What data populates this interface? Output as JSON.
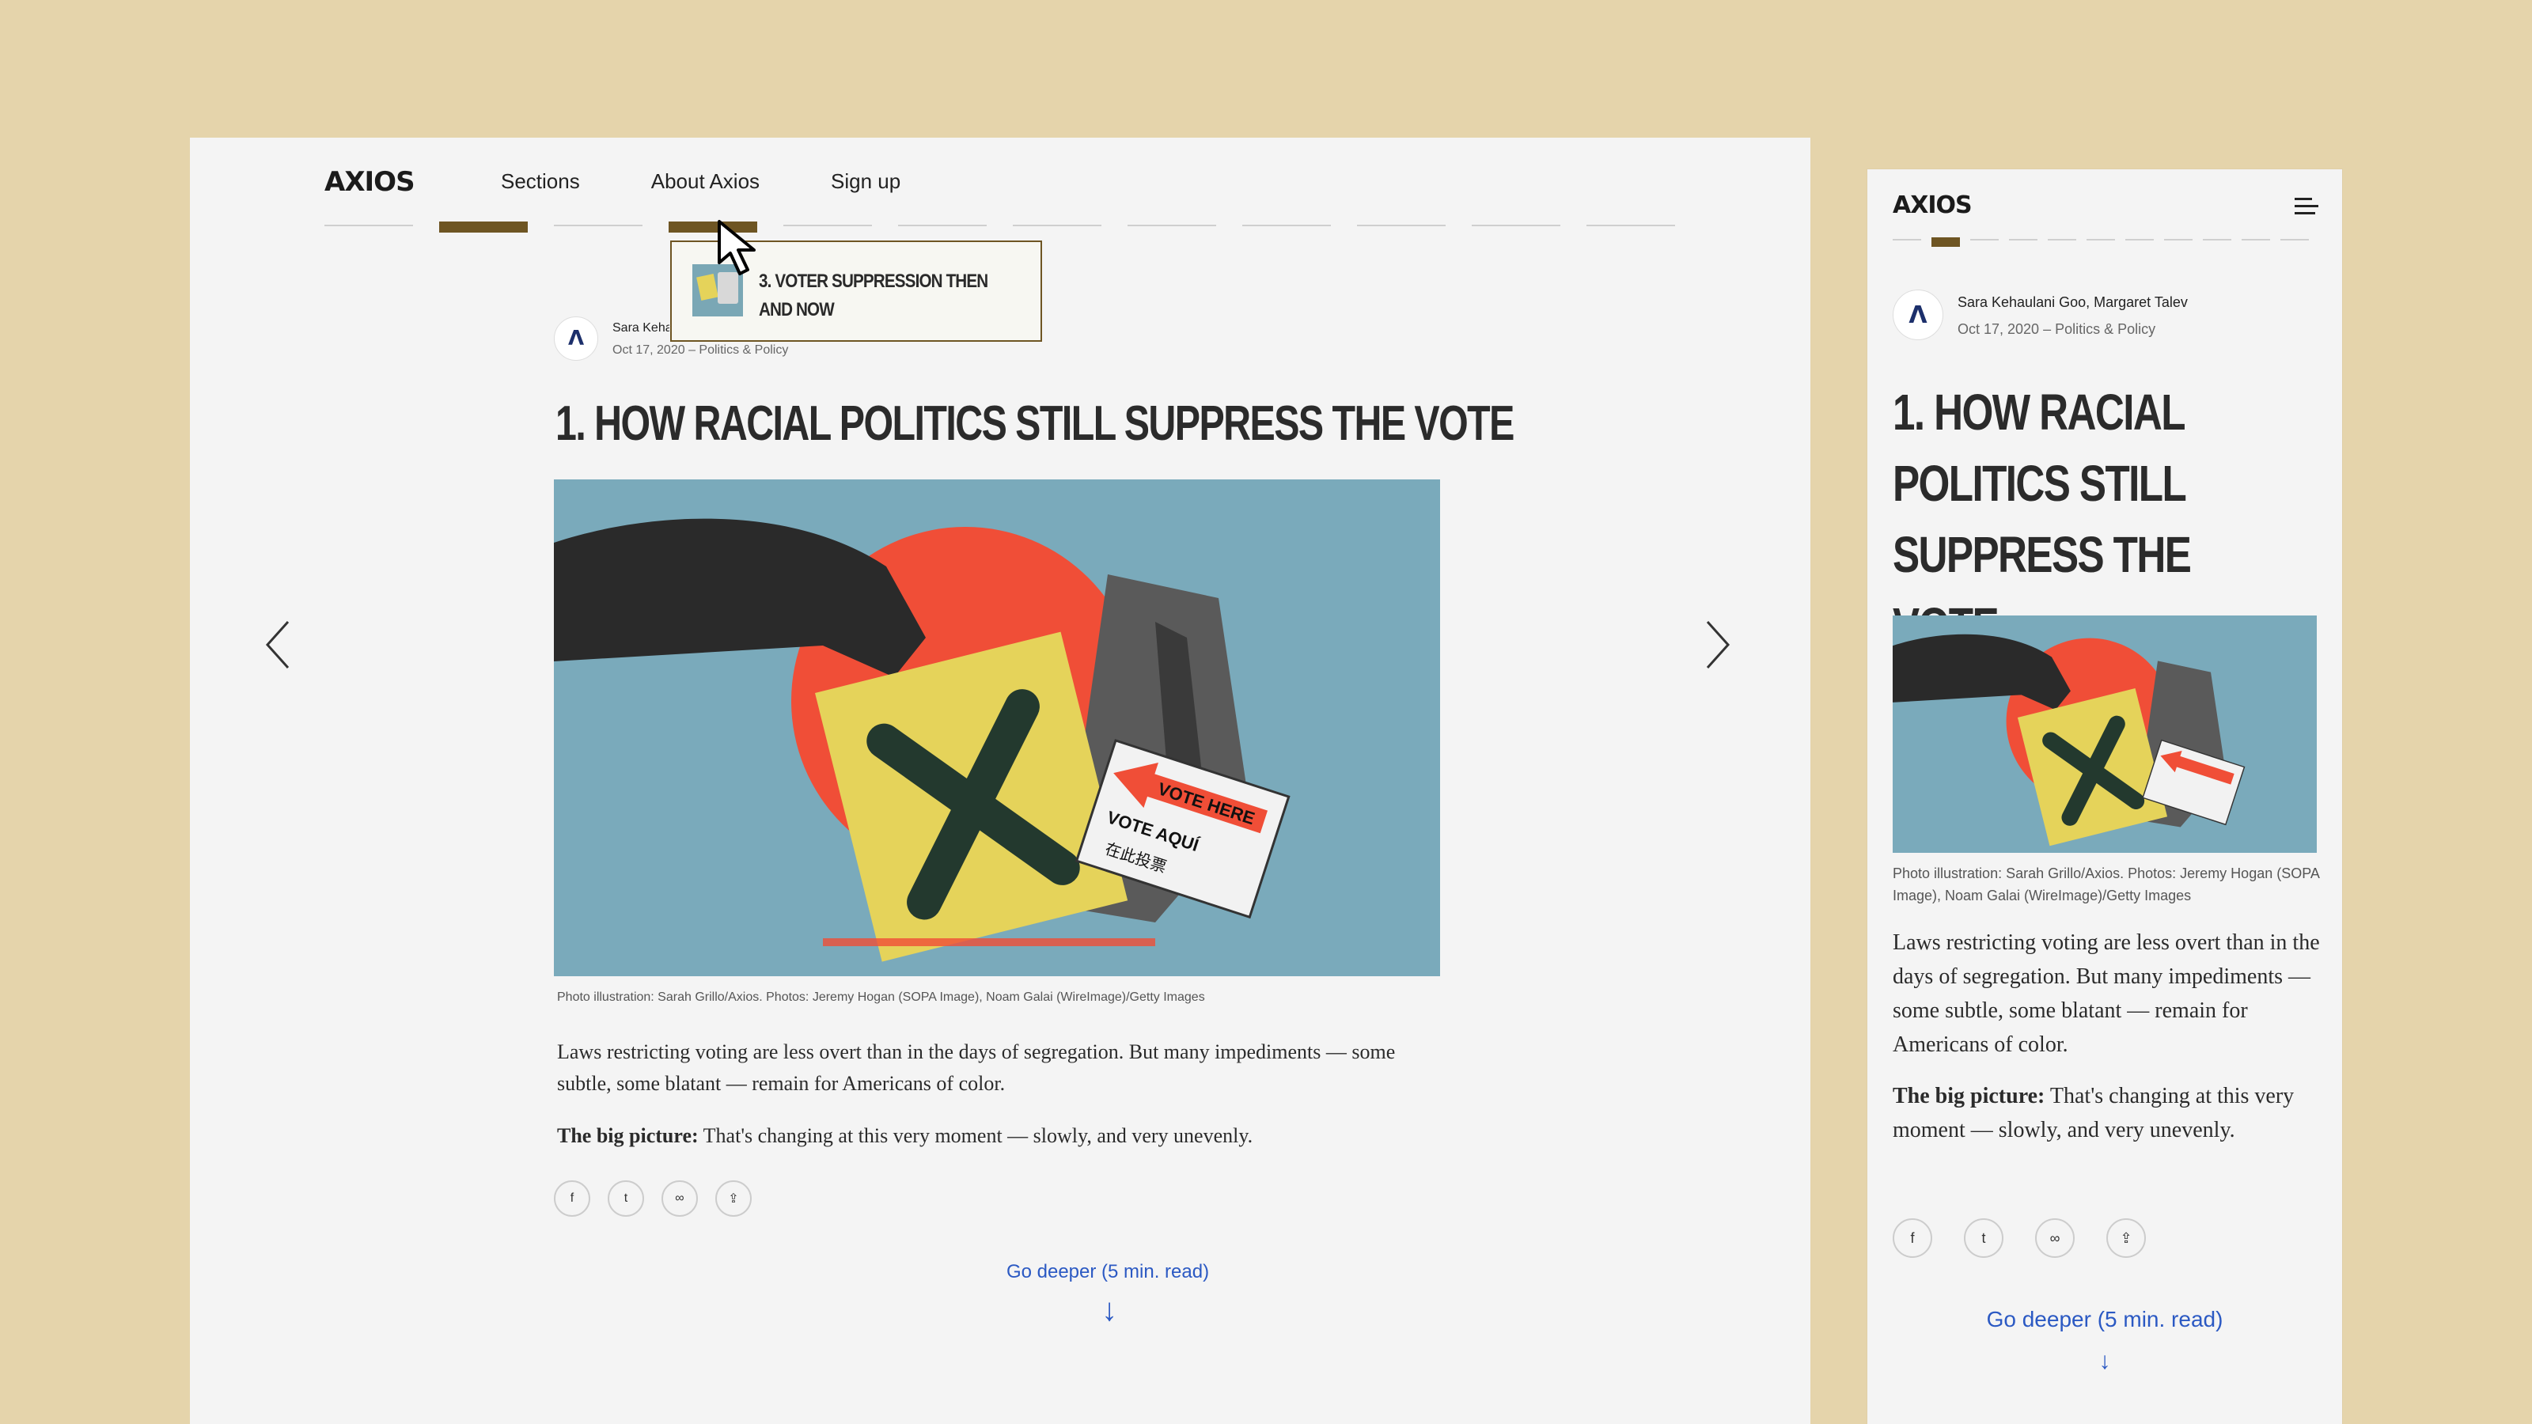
{
  "brand": {
    "logo": "AXIOS",
    "accent": "#6e5523",
    "link_color": "#2b59c3",
    "background": "#e5d4ab"
  },
  "desktop": {
    "nav": {
      "sections": "Sections",
      "about": "About Axios",
      "signup": "Sign up"
    },
    "progress": {
      "total": 12,
      "active_index": 1,
      "hovered_index": 3
    },
    "tooltip": {
      "title": "3. VOTER SUPPRESSION THEN AND NOW"
    },
    "byline": {
      "author_truncated": "Sara Kehaulani Goo, Margaret Talev",
      "meta": "Oct 17, 2020 – Politics & Policy"
    },
    "headline": "1. HOW RACIAL POLITICS STILL SUPPRESS THE VOTE",
    "caption": "Photo illustration: Sarah Grillo/Axios. Photos: Jeremy Hogan (SOPA Image), Noam Galai (WireImage)/Getty Images",
    "body1": "Laws restricting voting are less overt than in the days of segregation. But many impediments — some subtle, some blatant — remain for Americans of color.",
    "body2_lead": "The big picture:",
    "body2_rest": " That's changing at this very moment — slowly, and very unevenly.",
    "go_deeper": "Go deeper (5 min. read)",
    "arrow": "↓",
    "share_icons": [
      "facebook-icon",
      "twitter-icon",
      "link-icon",
      "share-icon"
    ],
    "share_glyphs": [
      "f",
      "t",
      "∞",
      "⇪"
    ]
  },
  "mobile": {
    "progress": {
      "total": 11,
      "active_index": 1
    },
    "byline": {
      "author": "Sara Kehaulani Goo, Margaret Talev",
      "meta": "Oct 17, 2020 – Politics & Policy"
    },
    "headline": "1. HOW RACIAL POLITICS STILL SUPPRESS THE VOTE",
    "caption": "Photo illustration: Sarah Grillo/Axios. Photos: Jeremy Hogan (SOPA Image), Noam Galai (WireImage)/Getty Images",
    "body1": "Laws restricting voting are less overt than in the days of segregation. But many impediments — some subtle, some blatant — remain for Americans of color.",
    "body2_lead": "The big picture:",
    "body2_rest": " That's changing at this very moment — slowly, and very unevenly.",
    "go_deeper": "Go deeper (5 min. read)",
    "arrow": "↓"
  },
  "illustration": {
    "sign_line1": "VOTE HERE",
    "sign_line2": "VOTE AQUÍ",
    "sign_line3": "在此投票"
  }
}
